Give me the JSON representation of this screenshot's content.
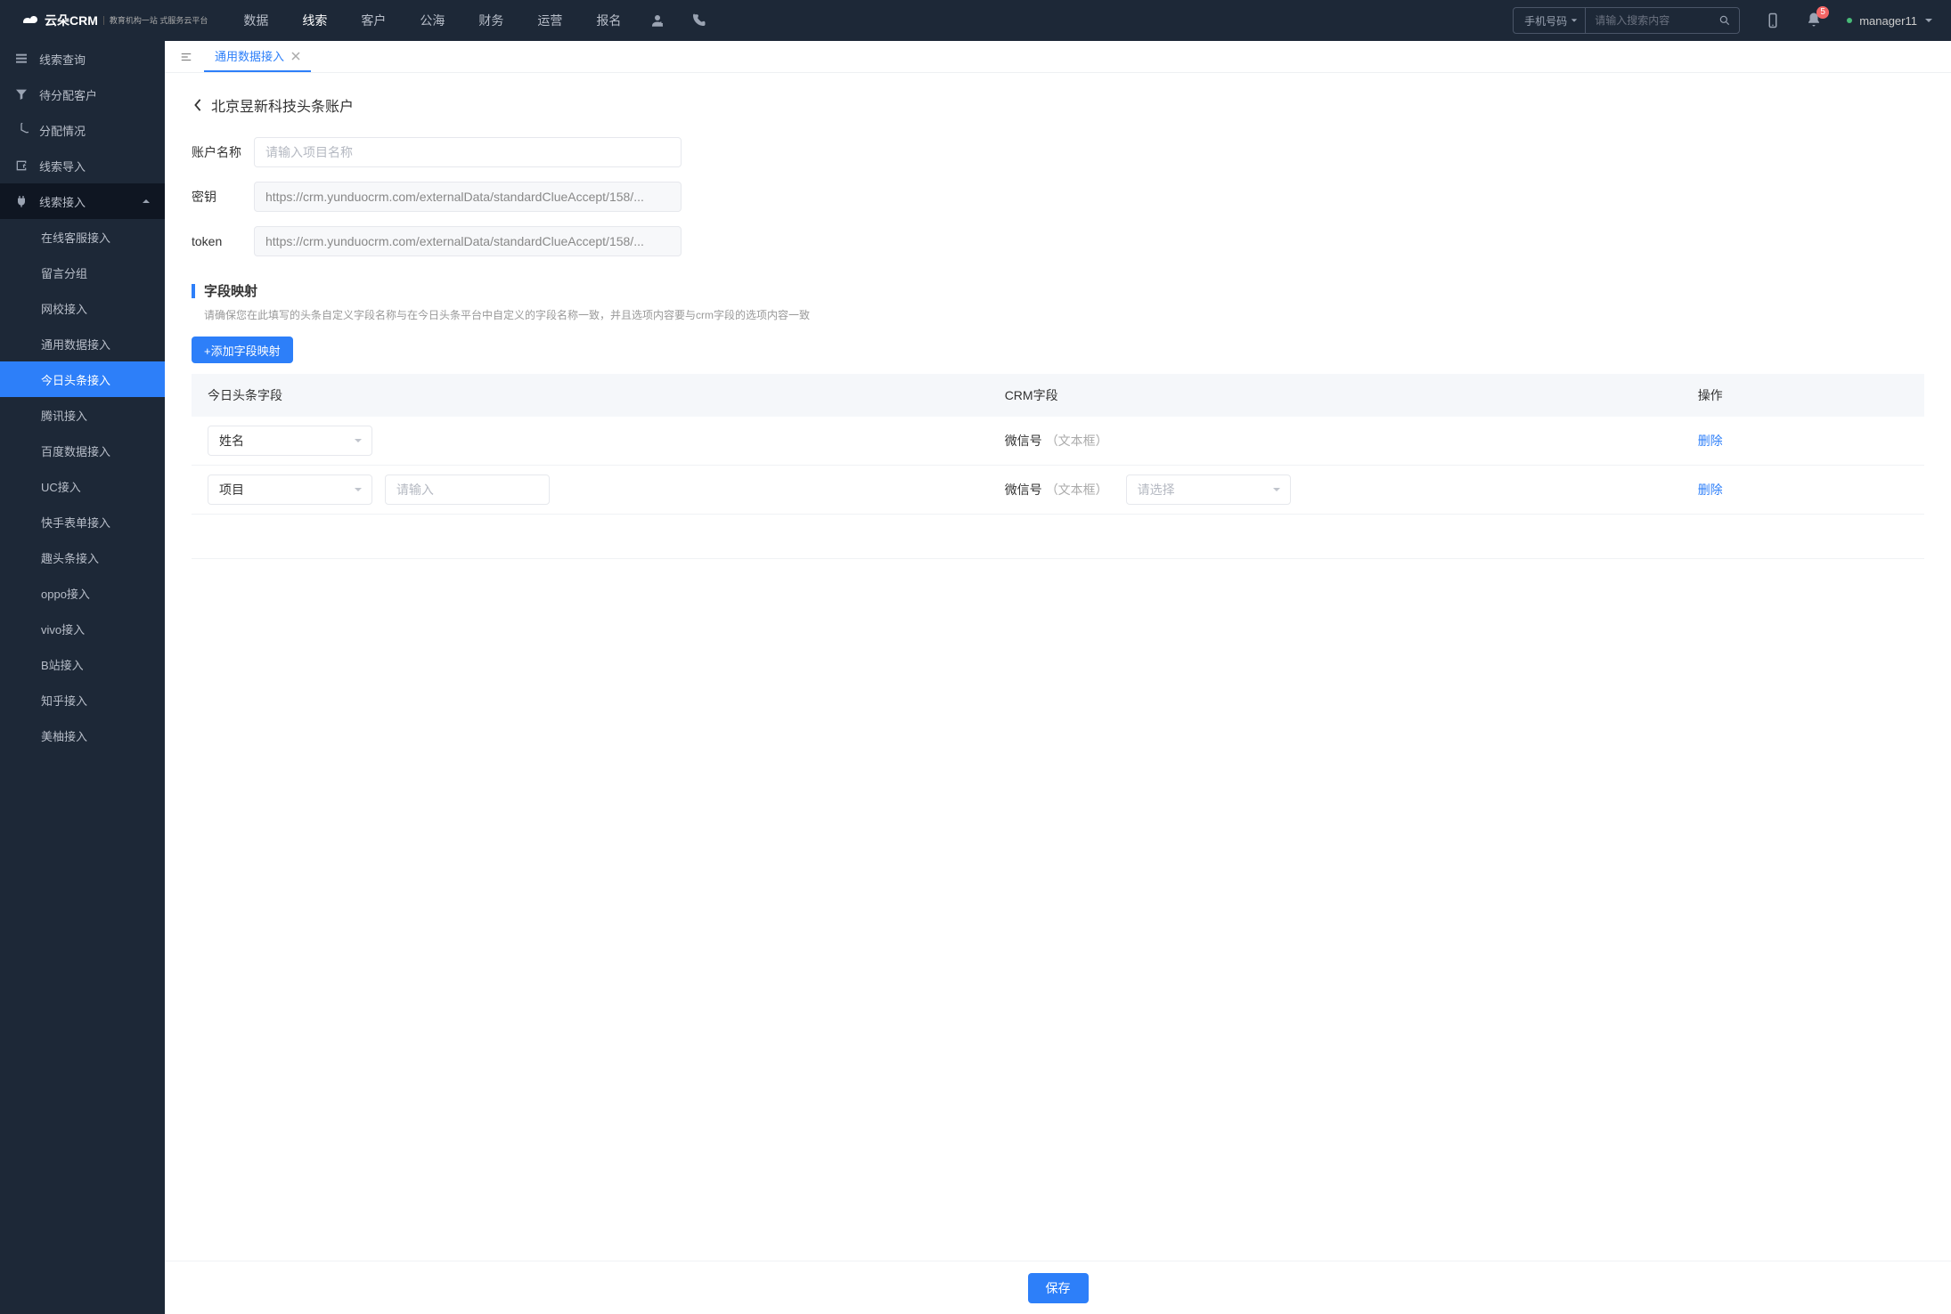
{
  "header": {
    "logo_text": "云朵CRM",
    "logo_sub": "教育机构一站\n式服务云平台",
    "nav": [
      "数据",
      "线索",
      "客户",
      "公海",
      "财务",
      "运营",
      "报名"
    ],
    "nav_active_index": 1,
    "search_select": "手机号码",
    "search_placeholder": "请输入搜索内容",
    "notif_count": "5",
    "user_name": "manager11"
  },
  "sidebar": {
    "items": [
      "线索查询",
      "待分配客户",
      "分配情况",
      "线索导入",
      "线索接入"
    ],
    "expanded_index": 4,
    "sub_items": [
      "在线客服接入",
      "留言分组",
      "网校接入",
      "通用数据接入",
      "今日头条接入",
      "腾讯接入",
      "百度数据接入",
      "UC接入",
      "快手表单接入",
      "趣头条接入",
      "oppo接入",
      "vivo接入",
      "B站接入",
      "知乎接入",
      "美柚接入"
    ],
    "active_sub_index": 4
  },
  "tabs": {
    "label": "通用数据接入"
  },
  "page": {
    "breadcrumb_title": "北京昱新科技头条账户",
    "form": {
      "account_label": "账户名称",
      "account_placeholder": "请输入项目名称",
      "secret_label": "密钥",
      "secret_value": "https://crm.yunduocrm.com/externalData/standardClueAccept/158/...",
      "token_label": "token",
      "token_value": "https://crm.yunduocrm.com/externalData/standardClueAccept/158/..."
    },
    "section": {
      "title": "字段映射",
      "desc": "请确保您在此填写的头条自定义字段名称与在今日头条平台中自定义的字段名称一致，并且选项内容要与crm字段的选项内容一致",
      "add_btn": "+添加字段映射"
    },
    "table": {
      "columns": [
        "今日头条字段",
        "CRM字段",
        "操作"
      ],
      "rows": [
        {
          "toutiao_value": "姓名",
          "crm_label": "微信号",
          "crm_type": "（文本框）",
          "delete": "删除"
        },
        {
          "toutiao_value": "项目",
          "toutiao_input_placeholder": "请输入",
          "crm_label": "微信号",
          "crm_type": "（文本框）",
          "crm_select_placeholder": "请选择",
          "delete": "删除"
        }
      ]
    },
    "save_btn": "保存"
  }
}
